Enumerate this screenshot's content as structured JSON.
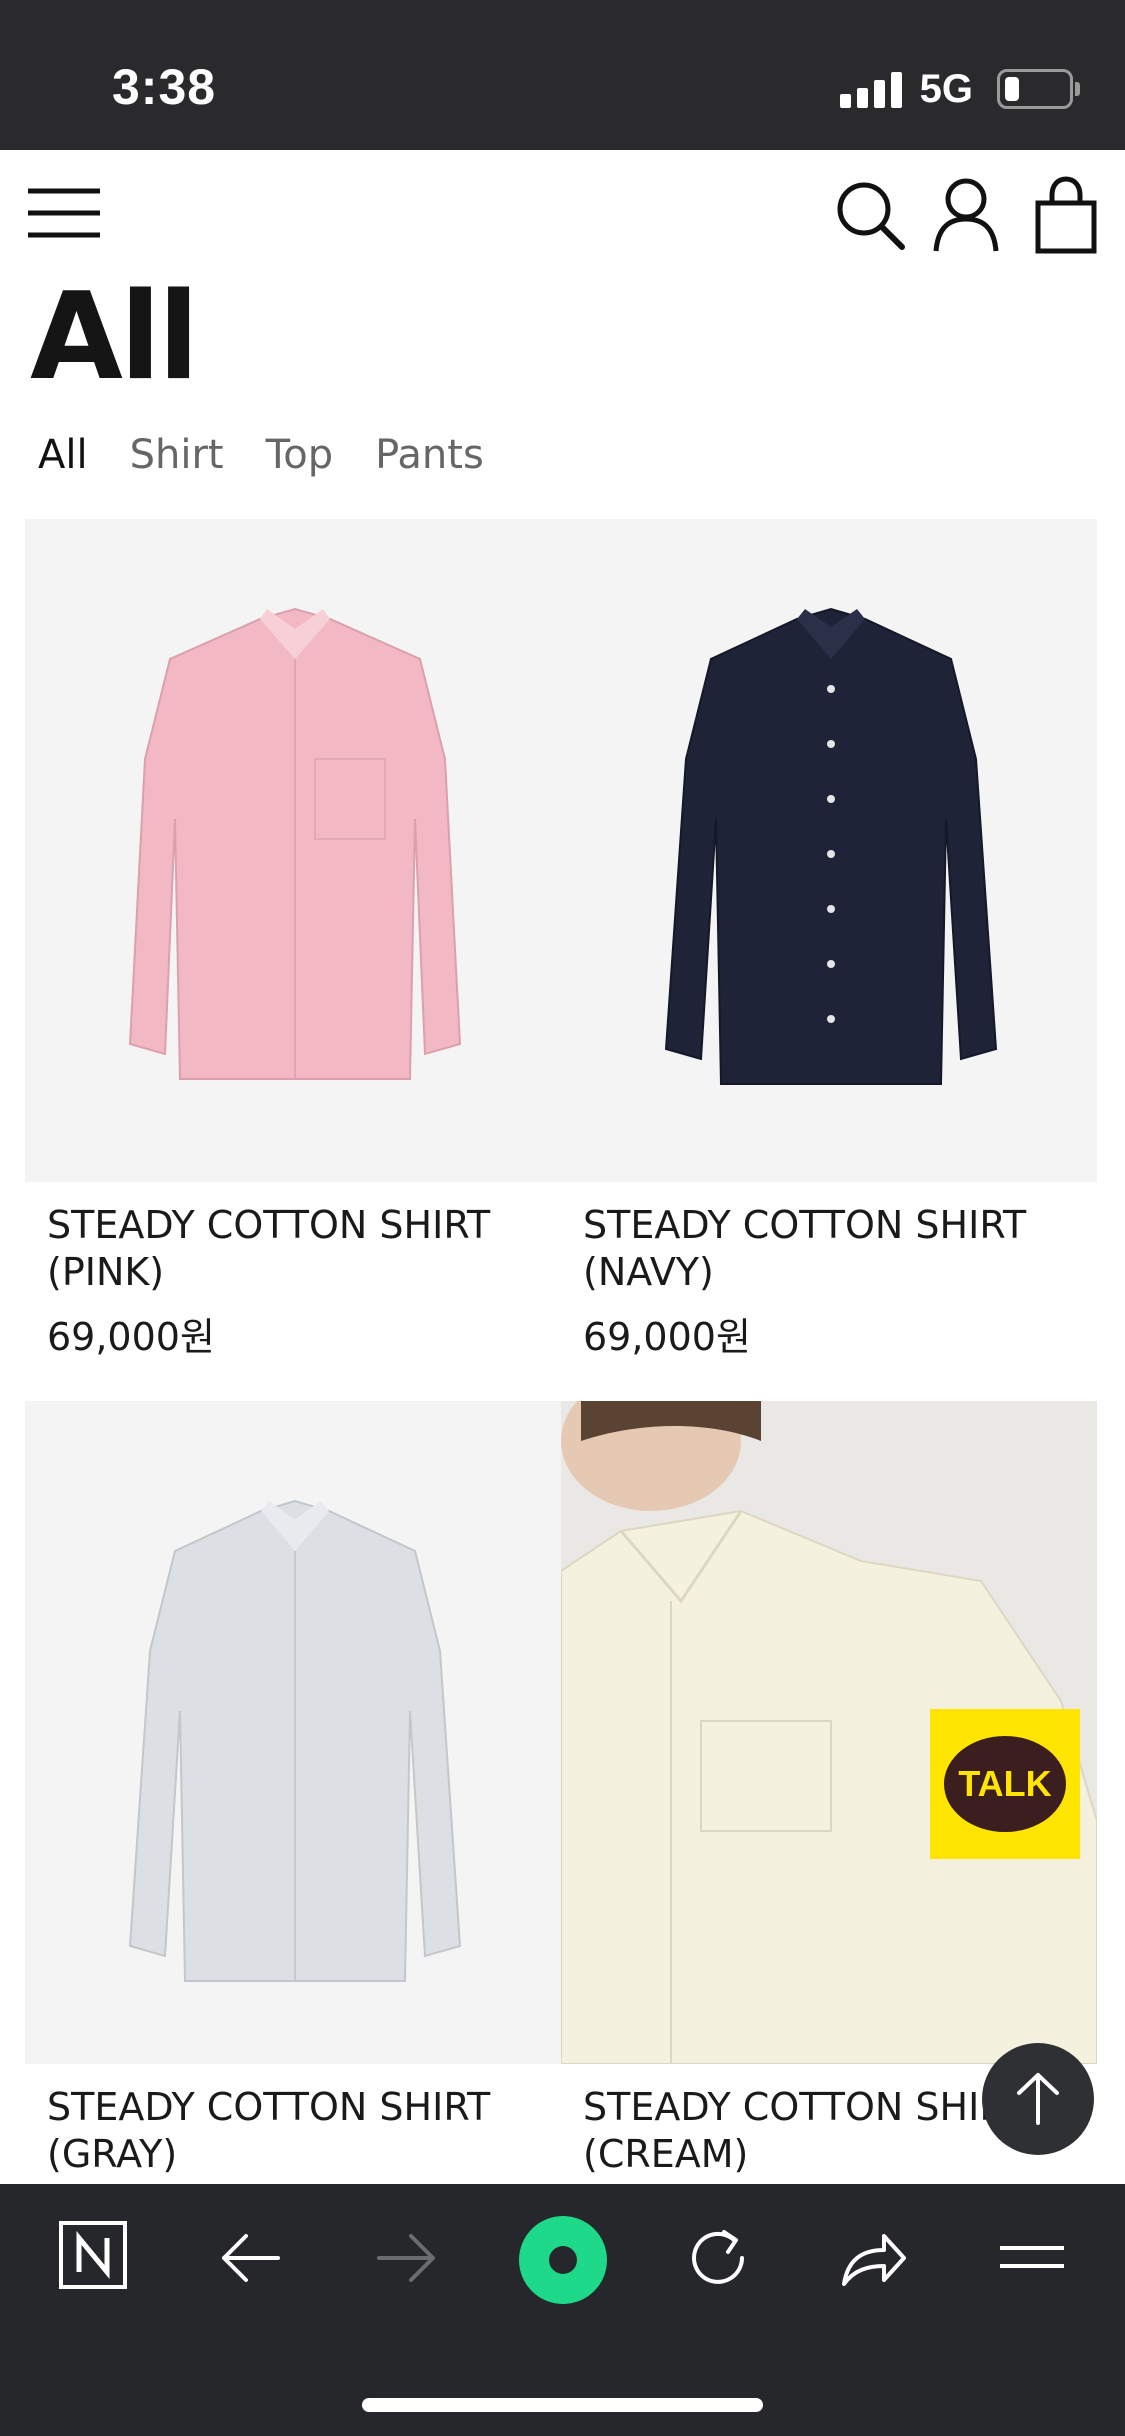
{
  "status_bar": {
    "time": "3:38",
    "network": "5G",
    "battery_level": 0.25
  },
  "header": {
    "menu_icon": "hamburger-icon",
    "search_icon": "search-icon",
    "account_icon": "user-icon",
    "cart_icon": "shopping-bag-icon"
  },
  "page": {
    "title": "All"
  },
  "tabs": [
    {
      "label": "All",
      "active": true
    },
    {
      "label": "Shirt",
      "active": false
    },
    {
      "label": "Top",
      "active": false
    },
    {
      "label": "Pants",
      "active": false
    }
  ],
  "products": [
    {
      "name_line1": "STEADY COTTON SHIRT",
      "name_line2": "(PINK)",
      "price": "69,000원",
      "color": "#f2b9c4"
    },
    {
      "name_line1": "STEADY COTTON SHIRT",
      "name_line2": "(NAVY)",
      "price": "69,000원",
      "color": "#1e2338"
    },
    {
      "name_line1": "STEADY COTTON SHIRT",
      "name_line2": "(GRAY)",
      "price": "",
      "color": "#d7dade"
    },
    {
      "name_line1": "STEADY COTTON SHIRT",
      "name_line2": "(CREAM)",
      "price": "",
      "color": "#f5f1df"
    }
  ],
  "floating": {
    "talk_label": "TALK",
    "scroll_top_icon": "arrow-up-icon"
  },
  "browser_bar": {
    "icons": [
      "naver-n-icon",
      "back-arrow-icon",
      "forward-arrow-icon",
      "green-dot-icon",
      "refresh-icon",
      "share-icon",
      "menu-icon"
    ]
  },
  "colors": {
    "accent_green": "#1ed98a",
    "kakao_yellow": "#ffe500"
  }
}
